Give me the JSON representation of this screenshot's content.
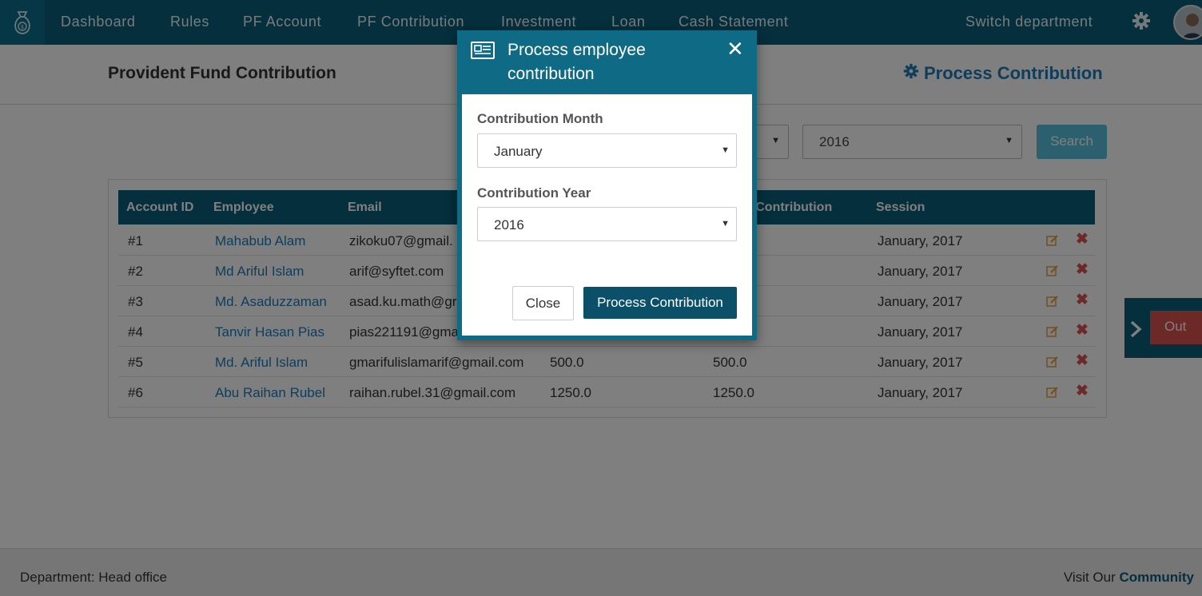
{
  "nav": {
    "items": [
      "Dashboard",
      "Rules",
      "PF Account",
      "PF Contribution",
      "Investment",
      "Loan",
      "Cash Statement"
    ],
    "switch_department": "Switch department"
  },
  "header": {
    "title": "Provident Fund Contribution",
    "process_link": "Process Contribution"
  },
  "filters": {
    "month_selected": "",
    "year_selected": "2016",
    "search_label": "Search"
  },
  "table": {
    "columns": [
      "Account ID",
      "Employee",
      "Email",
      "",
      "ee Contribution",
      "Session"
    ],
    "rows": [
      {
        "id": "#1",
        "employee": "Mahabub Alam",
        "email": "zikoku07@gmail.",
        "c1": "",
        "c2": "",
        "session": "January, 2017"
      },
      {
        "id": "#2",
        "employee": "Md Ariful Islam",
        "email": "arif@syftet.com",
        "c1": "",
        "c2": "",
        "session": "January, 2017"
      },
      {
        "id": "#3",
        "employee": "Md. Asaduzzaman",
        "email": "asad.ku.math@gr",
        "c1": "",
        "c2": "",
        "session": "January, 2017"
      },
      {
        "id": "#4",
        "employee": "Tanvir Hasan Pias",
        "email": "pias221191@gma",
        "c1": "",
        "c2": "",
        "session": "January, 2017"
      },
      {
        "id": "#5",
        "employee": "Md. Ariful Islam",
        "email": "gmarifulislamarif@gmail.com",
        "c1": "500.0",
        "c2": "500.0",
        "session": "January, 2017"
      },
      {
        "id": "#6",
        "employee": "Abu Raihan Rubel",
        "email": "raihan.rubel.31@gmail.com",
        "c1": "1250.0",
        "c2": "1250.0",
        "session": "January, 2017"
      }
    ]
  },
  "side": {
    "out_label": "Out"
  },
  "footer": {
    "department": "Department: Head office",
    "visit_prefix": "Visit Our",
    "community": "Community"
  },
  "modal": {
    "title": "Process employee contribution",
    "month_label": "Contribution Month",
    "month_value": "January",
    "year_label": "Contribution Year",
    "year_value": "2016",
    "close_label": "Close",
    "process_label": "Process Contribution"
  },
  "colors": {
    "nav_bg": "#0b5e7a",
    "link": "#1f7ab8",
    "danger": "#d9534f",
    "edit": "#e0a040"
  }
}
